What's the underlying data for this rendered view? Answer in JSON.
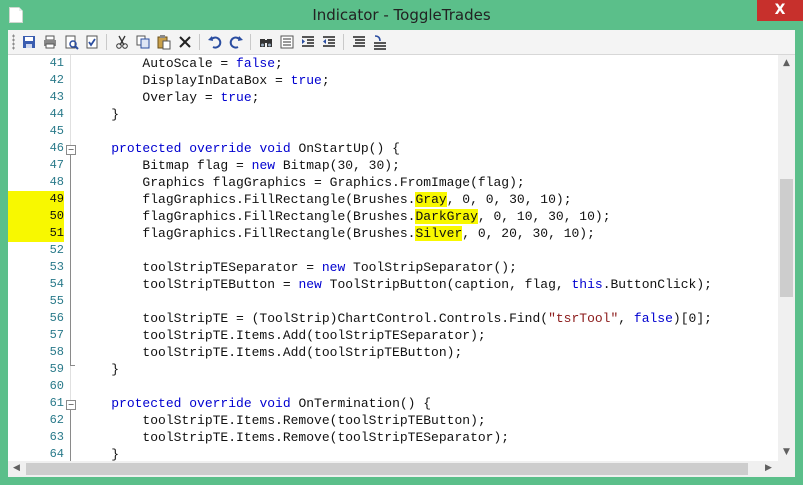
{
  "window": {
    "title": "Indicator - ToggleTrades",
    "close_label": "X"
  },
  "toolbar": {
    "buttons": [
      "save-icon",
      "print-icon",
      "print-preview-icon",
      "compile-icon",
      "cut-icon",
      "copy-icon",
      "paste-icon",
      "delete-icon",
      "undo-icon",
      "redo-icon",
      "find-icon",
      "replace-icon",
      "indent-icon",
      "outdent-icon",
      "comment-icon",
      "uncomment-icon"
    ]
  },
  "editor": {
    "lines": [
      {
        "num": "41",
        "segs": [
          {
            "t": "        AutoScale = "
          },
          {
            "t": "false",
            "c": "kw"
          },
          {
            "t": ";"
          }
        ]
      },
      {
        "num": "42",
        "segs": [
          {
            "t": "        DisplayInDataBox = "
          },
          {
            "t": "true",
            "c": "kw"
          },
          {
            "t": ";"
          }
        ]
      },
      {
        "num": "43",
        "segs": [
          {
            "t": "        Overlay = "
          },
          {
            "t": "true",
            "c": "kw"
          },
          {
            "t": ";"
          }
        ]
      },
      {
        "num": "44",
        "segs": [
          {
            "t": "    }"
          }
        ]
      },
      {
        "num": "45",
        "segs": []
      },
      {
        "num": "46",
        "segs": [
          {
            "t": "    "
          },
          {
            "t": "protected override void",
            "c": "kw"
          },
          {
            "t": " OnStartUp() {"
          }
        ]
      },
      {
        "num": "47",
        "segs": [
          {
            "t": "        Bitmap flag = "
          },
          {
            "t": "new",
            "c": "kw"
          },
          {
            "t": " Bitmap(30, 30);"
          }
        ]
      },
      {
        "num": "48",
        "segs": [
          {
            "t": "        Graphics flagGraphics = Graphics.FromImage(flag);"
          }
        ]
      },
      {
        "num": "49",
        "hl": true,
        "segs": [
          {
            "t": "        flagGraphics.FillRectangle(Brushes."
          },
          {
            "t": "Gray",
            "c": "hlt"
          },
          {
            "t": ", 0, 0, 30, 10);"
          }
        ]
      },
      {
        "num": "50",
        "hl": true,
        "segs": [
          {
            "t": "        flagGraphics.FillRectangle(Brushes."
          },
          {
            "t": "DarkGray",
            "c": "hlt"
          },
          {
            "t": ", 0, 10, 30, 10);"
          }
        ]
      },
      {
        "num": "51",
        "hl": true,
        "segs": [
          {
            "t": "        flagGraphics.FillRectangle(Brushes."
          },
          {
            "t": "Silver",
            "c": "hlt"
          },
          {
            "t": ", 0, 20, 30, 10);"
          }
        ]
      },
      {
        "num": "52",
        "segs": []
      },
      {
        "num": "53",
        "segs": [
          {
            "t": "        toolStripTESeparator = "
          },
          {
            "t": "new",
            "c": "kw"
          },
          {
            "t": " ToolStripSeparator();"
          }
        ]
      },
      {
        "num": "54",
        "segs": [
          {
            "t": "        toolStripTEButton = "
          },
          {
            "t": "new",
            "c": "kw"
          },
          {
            "t": " ToolStripButton(caption, flag, "
          },
          {
            "t": "this",
            "c": "kw"
          },
          {
            "t": ".ButtonClick);"
          }
        ]
      },
      {
        "num": "55",
        "segs": []
      },
      {
        "num": "56",
        "segs": [
          {
            "t": "        toolStripTE = (ToolStrip)ChartControl.Controls.Find("
          },
          {
            "t": "\"tsrTool\"",
            "c": "str"
          },
          {
            "t": ", "
          },
          {
            "t": "false",
            "c": "kw"
          },
          {
            "t": ")[0];"
          }
        ]
      },
      {
        "num": "57",
        "segs": [
          {
            "t": "        toolStripTE.Items.Add(toolStripTESeparator);"
          }
        ]
      },
      {
        "num": "58",
        "segs": [
          {
            "t": "        toolStripTE.Items.Add(toolStripTEButton);"
          }
        ]
      },
      {
        "num": "59",
        "segs": [
          {
            "t": "    }"
          }
        ]
      },
      {
        "num": "60",
        "segs": []
      },
      {
        "num": "61",
        "segs": [
          {
            "t": "    "
          },
          {
            "t": "protected override void",
            "c": "kw"
          },
          {
            "t": " OnTermination() {"
          }
        ]
      },
      {
        "num": "62",
        "segs": [
          {
            "t": "        toolStripTE.Items.Remove(toolStripTEButton);"
          }
        ]
      },
      {
        "num": "63",
        "segs": [
          {
            "t": "        toolStripTE.Items.Remove(toolStripTESeparator);"
          }
        ]
      },
      {
        "num": "64",
        "segs": [
          {
            "t": "    }"
          }
        ]
      }
    ]
  },
  "colors": {
    "frame": "#5bbf8a",
    "keyword": "#0000d0",
    "highlight": "#f8f800",
    "line_number": "#2a7a8a"
  }
}
